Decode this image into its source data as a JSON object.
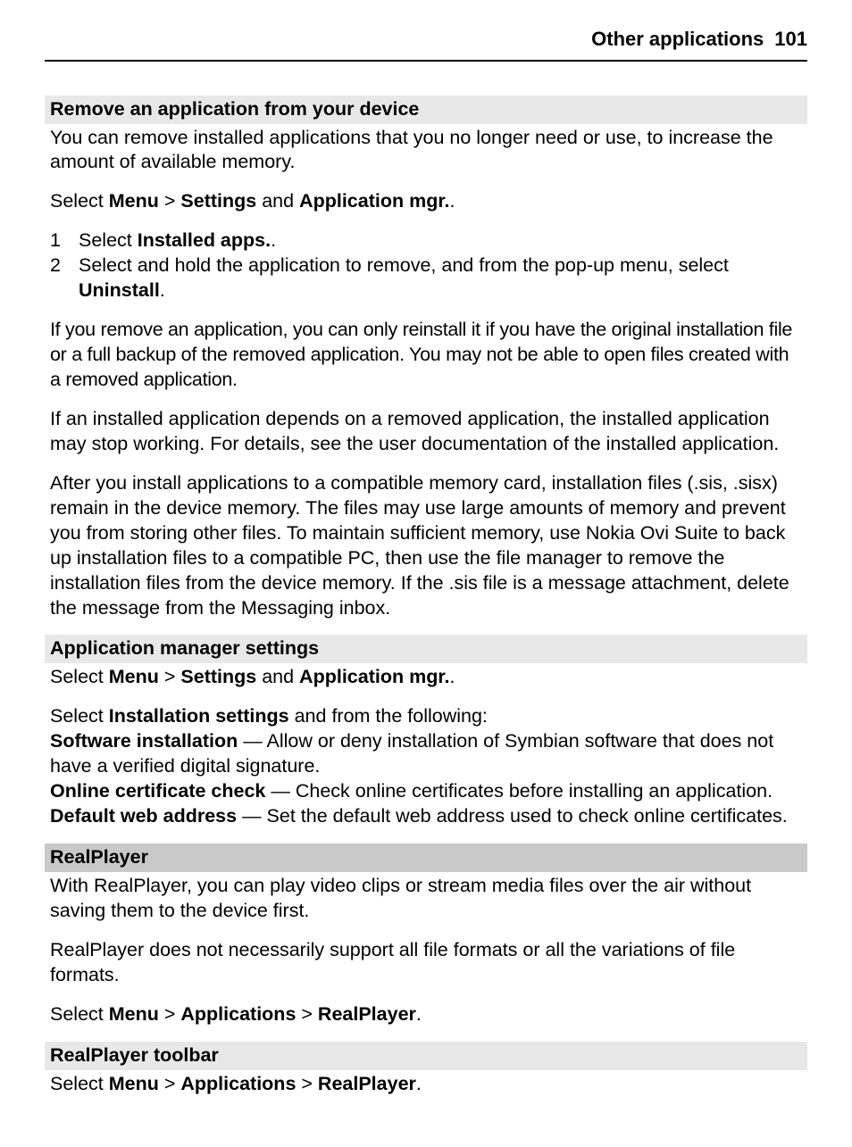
{
  "header": {
    "title": "Other applications",
    "page": "101"
  },
  "sec1": {
    "heading": "Remove an application from your device",
    "intro": "You can remove installed applications that you no longer need or use, to increase the amount of available memory.",
    "nav": {
      "pre": "Select ",
      "menu": "Menu",
      "sep1": " > ",
      "settings": "Settings",
      "and": " and ",
      "appmgr": "Application mgr.",
      "end": "."
    },
    "steps": [
      {
        "n": "1",
        "pre": "Select ",
        "bold": "Installed apps.",
        "post": "."
      },
      {
        "n": "2",
        "pre": "Select and hold the application to remove, and from the pop-up menu, select ",
        "bold": "Uninstall",
        "post": "."
      }
    ],
    "p2": "If you remove an application, you can only reinstall it if you have the original installation file or a full backup of the removed application. You may not be able to open files created with a removed application.",
    "p3": "If an installed application depends on a removed application, the installed application may stop working. For details, see the user documentation of the installed application.",
    "p4": "After you install applications to a compatible memory card, installation files (.sis, .sisx) remain in the device memory. The files may use large amounts of memory and prevent you from storing other files. To maintain sufficient memory, use Nokia Ovi Suite to back up installation files to a compatible PC, then use the file manager to remove the installation files from the device memory. If the .sis file is a message attachment, delete the message from the Messaging inbox."
  },
  "sec2": {
    "heading": "Application manager settings",
    "nav": {
      "pre": "Select ",
      "menu": "Menu",
      "sep1": " > ",
      "settings": "Settings",
      "and": " and ",
      "appmgr": "Application mgr.",
      "end": "."
    },
    "instsel": {
      "pre": "Select ",
      "bold": "Installation settings",
      "post": " and from the following:"
    },
    "opts": [
      {
        "label": "Software installation",
        "desc": " — Allow or deny installation of Symbian software that does not have a verified digital signature."
      },
      {
        "label": "Online certificate check",
        "desc": " — Check online certificates before installing an application."
      },
      {
        "label": "Default web address",
        "desc": " — Set the default web address used to check online certificates."
      }
    ]
  },
  "sec3": {
    "heading": "RealPlayer",
    "p1": "With RealPlayer, you can play video clips or stream media files over the air without saving them to the device first.",
    "p2": "RealPlayer does not necessarily support all file formats or all the variations of file formats.",
    "nav": {
      "pre": "Select ",
      "menu": "Menu",
      "sep1": " > ",
      "apps": "Applications",
      "sep2": " > ",
      "real": "RealPlayer",
      "end": "."
    }
  },
  "sec4": {
    "heading": "RealPlayer toolbar",
    "nav": {
      "pre": "Select ",
      "menu": "Menu",
      "sep1": " > ",
      "apps": "Applications",
      "sep2": " > ",
      "real": "RealPlayer",
      "end": "."
    }
  }
}
